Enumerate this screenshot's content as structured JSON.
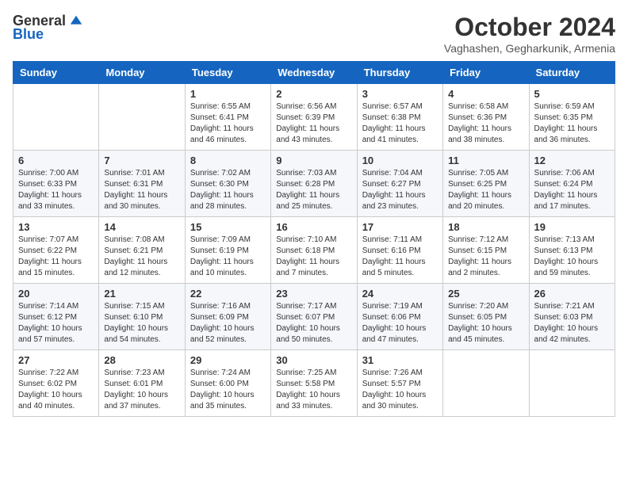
{
  "header": {
    "logo": {
      "general": "General",
      "blue": "Blue"
    },
    "title": "October 2024",
    "location": "Vaghashen, Gegharkunik, Armenia"
  },
  "days_of_week": [
    "Sunday",
    "Monday",
    "Tuesday",
    "Wednesday",
    "Thursday",
    "Friday",
    "Saturday"
  ],
  "weeks": [
    [
      {
        "day": "",
        "info": ""
      },
      {
        "day": "",
        "info": ""
      },
      {
        "day": "1",
        "info": "Sunrise: 6:55 AM\nSunset: 6:41 PM\nDaylight: 11 hours and 46 minutes."
      },
      {
        "day": "2",
        "info": "Sunrise: 6:56 AM\nSunset: 6:39 PM\nDaylight: 11 hours and 43 minutes."
      },
      {
        "day": "3",
        "info": "Sunrise: 6:57 AM\nSunset: 6:38 PM\nDaylight: 11 hours and 41 minutes."
      },
      {
        "day": "4",
        "info": "Sunrise: 6:58 AM\nSunset: 6:36 PM\nDaylight: 11 hours and 38 minutes."
      },
      {
        "day": "5",
        "info": "Sunrise: 6:59 AM\nSunset: 6:35 PM\nDaylight: 11 hours and 36 minutes."
      }
    ],
    [
      {
        "day": "6",
        "info": "Sunrise: 7:00 AM\nSunset: 6:33 PM\nDaylight: 11 hours and 33 minutes."
      },
      {
        "day": "7",
        "info": "Sunrise: 7:01 AM\nSunset: 6:31 PM\nDaylight: 11 hours and 30 minutes."
      },
      {
        "day": "8",
        "info": "Sunrise: 7:02 AM\nSunset: 6:30 PM\nDaylight: 11 hours and 28 minutes."
      },
      {
        "day": "9",
        "info": "Sunrise: 7:03 AM\nSunset: 6:28 PM\nDaylight: 11 hours and 25 minutes."
      },
      {
        "day": "10",
        "info": "Sunrise: 7:04 AM\nSunset: 6:27 PM\nDaylight: 11 hours and 23 minutes."
      },
      {
        "day": "11",
        "info": "Sunrise: 7:05 AM\nSunset: 6:25 PM\nDaylight: 11 hours and 20 minutes."
      },
      {
        "day": "12",
        "info": "Sunrise: 7:06 AM\nSunset: 6:24 PM\nDaylight: 11 hours and 17 minutes."
      }
    ],
    [
      {
        "day": "13",
        "info": "Sunrise: 7:07 AM\nSunset: 6:22 PM\nDaylight: 11 hours and 15 minutes."
      },
      {
        "day": "14",
        "info": "Sunrise: 7:08 AM\nSunset: 6:21 PM\nDaylight: 11 hours and 12 minutes."
      },
      {
        "day": "15",
        "info": "Sunrise: 7:09 AM\nSunset: 6:19 PM\nDaylight: 11 hours and 10 minutes."
      },
      {
        "day": "16",
        "info": "Sunrise: 7:10 AM\nSunset: 6:18 PM\nDaylight: 11 hours and 7 minutes."
      },
      {
        "day": "17",
        "info": "Sunrise: 7:11 AM\nSunset: 6:16 PM\nDaylight: 11 hours and 5 minutes."
      },
      {
        "day": "18",
        "info": "Sunrise: 7:12 AM\nSunset: 6:15 PM\nDaylight: 11 hours and 2 minutes."
      },
      {
        "day": "19",
        "info": "Sunrise: 7:13 AM\nSunset: 6:13 PM\nDaylight: 10 hours and 59 minutes."
      }
    ],
    [
      {
        "day": "20",
        "info": "Sunrise: 7:14 AM\nSunset: 6:12 PM\nDaylight: 10 hours and 57 minutes."
      },
      {
        "day": "21",
        "info": "Sunrise: 7:15 AM\nSunset: 6:10 PM\nDaylight: 10 hours and 54 minutes."
      },
      {
        "day": "22",
        "info": "Sunrise: 7:16 AM\nSunset: 6:09 PM\nDaylight: 10 hours and 52 minutes."
      },
      {
        "day": "23",
        "info": "Sunrise: 7:17 AM\nSunset: 6:07 PM\nDaylight: 10 hours and 50 minutes."
      },
      {
        "day": "24",
        "info": "Sunrise: 7:19 AM\nSunset: 6:06 PM\nDaylight: 10 hours and 47 minutes."
      },
      {
        "day": "25",
        "info": "Sunrise: 7:20 AM\nSunset: 6:05 PM\nDaylight: 10 hours and 45 minutes."
      },
      {
        "day": "26",
        "info": "Sunrise: 7:21 AM\nSunset: 6:03 PM\nDaylight: 10 hours and 42 minutes."
      }
    ],
    [
      {
        "day": "27",
        "info": "Sunrise: 7:22 AM\nSunset: 6:02 PM\nDaylight: 10 hours and 40 minutes."
      },
      {
        "day": "28",
        "info": "Sunrise: 7:23 AM\nSunset: 6:01 PM\nDaylight: 10 hours and 37 minutes."
      },
      {
        "day": "29",
        "info": "Sunrise: 7:24 AM\nSunset: 6:00 PM\nDaylight: 10 hours and 35 minutes."
      },
      {
        "day": "30",
        "info": "Sunrise: 7:25 AM\nSunset: 5:58 PM\nDaylight: 10 hours and 33 minutes."
      },
      {
        "day": "31",
        "info": "Sunrise: 7:26 AM\nSunset: 5:57 PM\nDaylight: 10 hours and 30 minutes."
      },
      {
        "day": "",
        "info": ""
      },
      {
        "day": "",
        "info": ""
      }
    ]
  ]
}
